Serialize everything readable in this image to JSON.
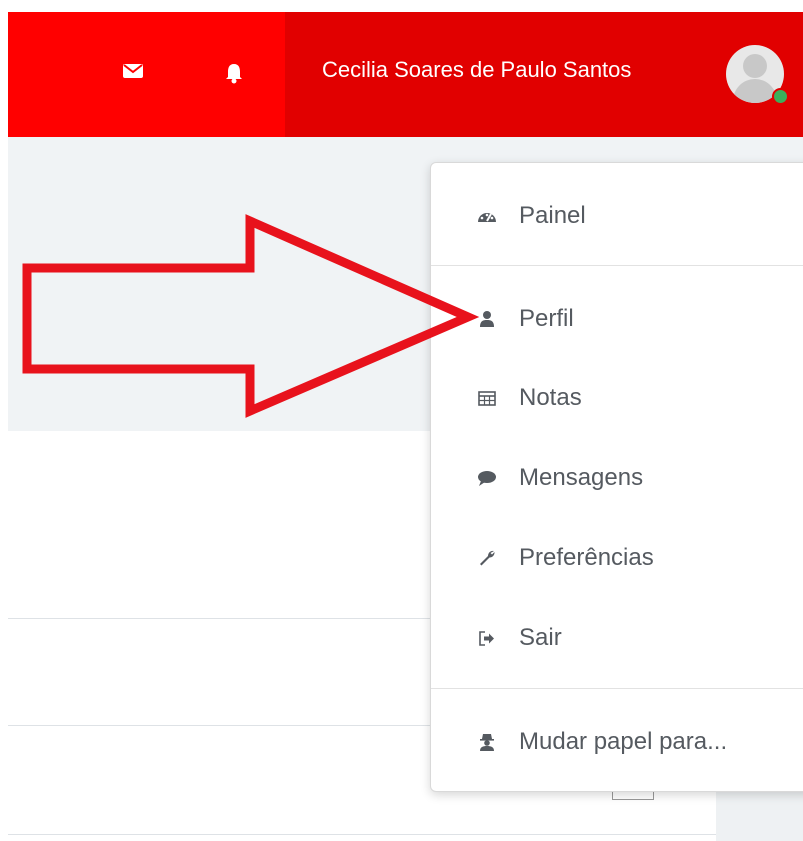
{
  "topbar": {
    "user_name": "Cecilia Soares de Paulo Santos",
    "icons": [
      "envelope-icon",
      "bell-icon"
    ],
    "colors": {
      "bar": "#ff0000",
      "user_area": "#e10000",
      "online": "#3aaf5b"
    }
  },
  "user_menu": {
    "items": [
      {
        "label": "Painel",
        "icon": "dashboard-icon"
      },
      {
        "label": "Perfil",
        "icon": "user-icon"
      },
      {
        "label": "Notas",
        "icon": "table-icon"
      },
      {
        "label": "Mensagens",
        "icon": "chat-bubble-icon"
      },
      {
        "label": "Preferências",
        "icon": "wrench-icon"
      },
      {
        "label": "Sair",
        "icon": "sign-out-icon"
      },
      {
        "label": "Mudar papel para...",
        "icon": "user-secret-icon"
      }
    ]
  },
  "annotation": {
    "shape": "arrow",
    "color": "#e8121c",
    "points_to": "Perfil"
  }
}
